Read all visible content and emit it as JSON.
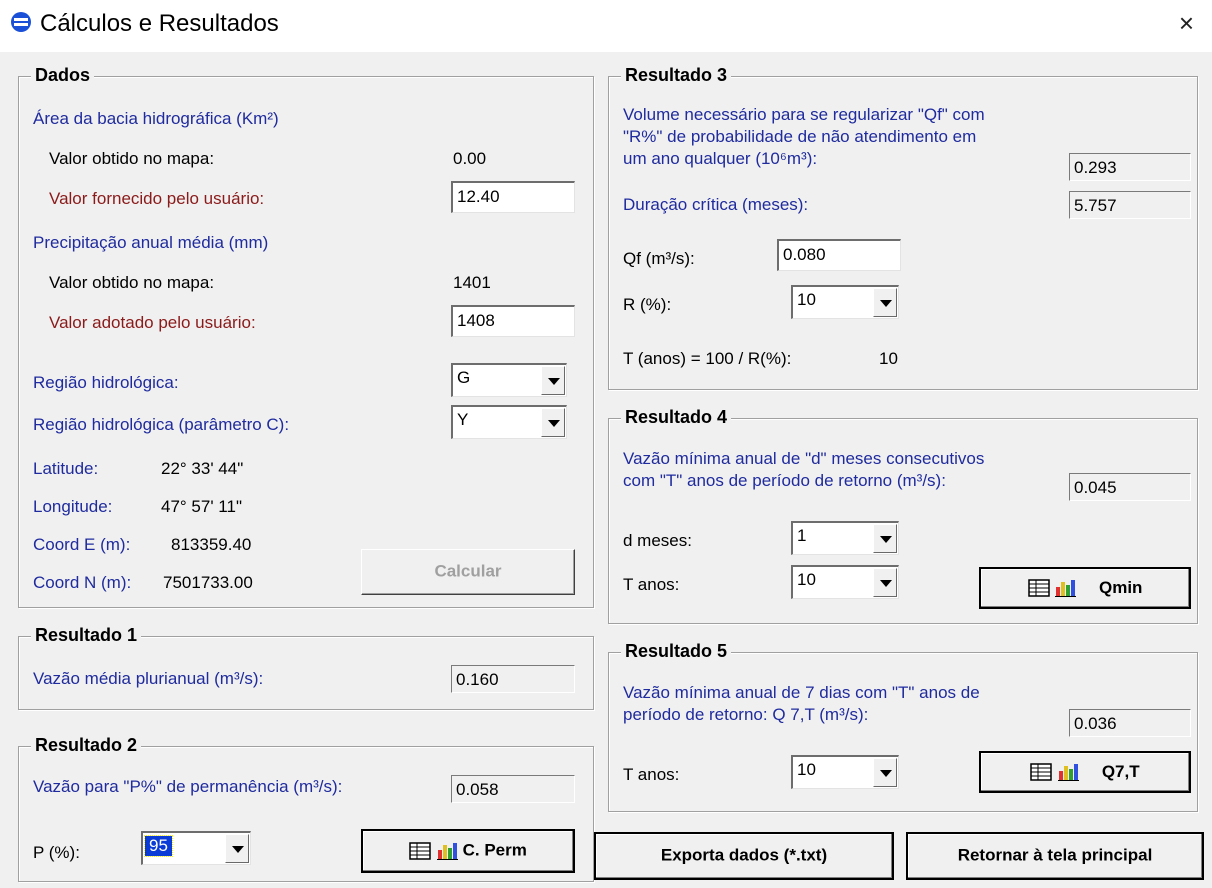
{
  "window": {
    "title": "Cálculos e Resultados",
    "close_label": "×"
  },
  "dados": {
    "title": "Dados",
    "area_header": "Área da bacia hidrográfica (Km²)",
    "area_map_label": "Valor obtido no mapa:",
    "area_map_value": "0.00",
    "area_user_label": "Valor fornecido pelo usuário:",
    "area_user_value": "12.40",
    "prec_header": "Precipitação anual média (mm)",
    "prec_map_label": "Valor obtido no mapa:",
    "prec_map_value": "1401",
    "prec_user_label": "Valor adotado pelo usuário:",
    "prec_user_value": "1408",
    "regiao_label": "Região hidrológica:",
    "regiao_value": "G",
    "regiao_c_label": "Região hidrológica (parâmetro C):",
    "regiao_c_value": "Y",
    "lat_label": "Latitude:",
    "lat_value": "22° 33' 44\"",
    "lon_label": "Longitude:",
    "lon_value": "47° 57' 11\"",
    "coord_e_label": "Coord E (m):",
    "coord_e_value": "813359.40",
    "coord_n_label": "Coord N (m):",
    "coord_n_value": "7501733.00",
    "calcular_label": "Calcular"
  },
  "resultado1": {
    "title": "Resultado 1",
    "label": "Vazão média plurianual (m³/s):",
    "value": "0.160"
  },
  "resultado2": {
    "title": "Resultado 2",
    "label": "Vazão para \"P%\" de permanência (m³/s):",
    "value": "0.058",
    "p_label": "P (%):",
    "p_value": "95",
    "button_label": "C. Perm"
  },
  "resultado3": {
    "title": "Resultado 3",
    "volume_line1": "Volume necessário para se regularizar \"Qf\" com",
    "volume_line2": "\"R%\" de probabilidade de não atendimento  em",
    "volume_line3": "um ano qualquer (10⁶m³):",
    "volume_value": "0.293",
    "duracao_label": "Duração crítica (meses):",
    "duracao_value": "5.757",
    "qf_label": "Qf (m³/s):",
    "qf_value": "0.080",
    "r_label": "R (%):",
    "r_value": "10",
    "t_label": "T (anos) = 100 / R(%):",
    "t_value": "10"
  },
  "resultado4": {
    "title": "Resultado 4",
    "line1": "Vazão mínima anual de \"d\" meses consecutivos",
    "line2": "com \"T\" anos de período de retorno (m³/s):",
    "value": "0.045",
    "d_label": "d meses:",
    "d_value": "1",
    "t_label": "T anos:",
    "t_value": "10",
    "button_label": "Qmin"
  },
  "resultado5": {
    "title": "Resultado 5",
    "line1": "Vazão mínima anual de 7 dias com \"T\" anos de",
    "line2": "período de retorno: Q 7,T  (m³/s):",
    "value": "0.036",
    "t_label": "T anos:",
    "t_value": "10",
    "button_label": "Q7,T"
  },
  "footer": {
    "exporta_label": "Exporta dados (*.txt)",
    "retornar_label": "Retornar à tela principal"
  },
  "colors": {
    "label_blue": "#1f2b9e",
    "label_red": "#8b1a1a",
    "window_bg": "#f0f0f0"
  },
  "icons": [
    "app-logo-icon",
    "close-icon",
    "table-icon",
    "bar-chart-icon"
  ]
}
